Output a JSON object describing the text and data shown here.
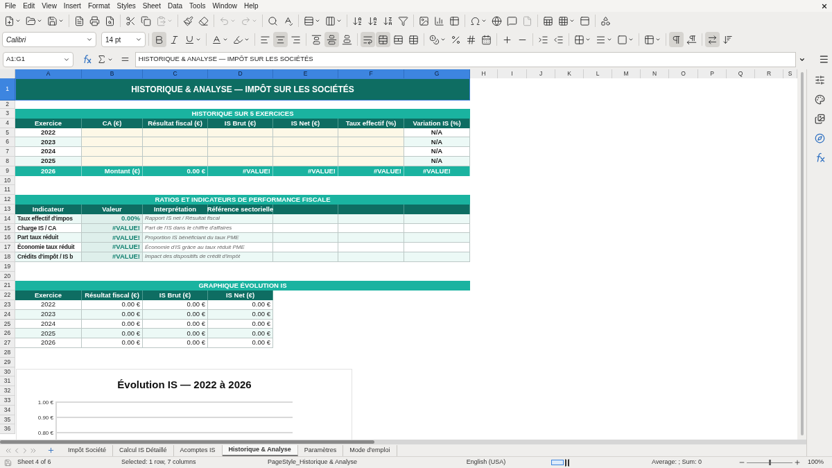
{
  "menu": [
    "File",
    "Edit",
    "View",
    "Insert",
    "Format",
    "Styles",
    "Sheet",
    "Data",
    "Tools",
    "Window",
    "Help"
  ],
  "toolbar_disabled": {
    "paste": true,
    "undo": true,
    "redo": true,
    "header_footer": true
  },
  "font_name": "Calibri",
  "font_size": "14 pt",
  "format_toggles": {
    "bold": true,
    "italic": false,
    "underline": false,
    "align_left": false,
    "align_center": true,
    "align_right": false,
    "align_top": false,
    "align_middle": true,
    "align_bottom": false,
    "wrap_text": true,
    "merge_center": true,
    "ltr": true,
    "rtl": false,
    "text_direction": true
  },
  "name_box": "A1:G1",
  "formula": "HISTORIQUE & ANALYSE — IMPÔT SUR LES SOCIÉTÉS",
  "column_headers": [
    {
      "label": "A",
      "selected": true
    },
    {
      "label": "B",
      "selected": true
    },
    {
      "label": "C",
      "selected": true
    },
    {
      "label": "D",
      "selected": true
    },
    {
      "label": "E",
      "selected": true
    },
    {
      "label": "F",
      "selected": true
    },
    {
      "label": "G",
      "selected": true
    },
    {
      "label": "H",
      "selected": false
    },
    {
      "label": "I",
      "selected": false
    },
    {
      "label": "J",
      "selected": false
    },
    {
      "label": "K",
      "selected": false
    },
    {
      "label": "L",
      "selected": false
    },
    {
      "label": "M",
      "selected": false
    },
    {
      "label": "N",
      "selected": false
    },
    {
      "label": "O",
      "selected": false
    },
    {
      "label": "P",
      "selected": false
    },
    {
      "label": "Q",
      "selected": false
    },
    {
      "label": "R",
      "selected": false
    },
    {
      "label": "S",
      "selected": false
    }
  ],
  "row_headers": [
    {
      "label": "1",
      "selected": true
    },
    {
      "label": "2",
      "selected": false
    },
    {
      "label": "3",
      "selected": false
    },
    {
      "label": "4",
      "selected": false
    },
    {
      "label": "5",
      "selected": false
    },
    {
      "label": "6",
      "selected": false
    },
    {
      "label": "7",
      "selected": false
    },
    {
      "label": "8",
      "selected": false
    },
    {
      "label": "9",
      "selected": false
    },
    {
      "label": "10",
      "selected": false
    },
    {
      "label": "11",
      "selected": false
    },
    {
      "label": "12",
      "selected": false
    },
    {
      "label": "13",
      "selected": false
    },
    {
      "label": "14",
      "selected": false
    },
    {
      "label": "15",
      "selected": false
    },
    {
      "label": "16",
      "selected": false
    },
    {
      "label": "17",
      "selected": false
    },
    {
      "label": "18",
      "selected": false
    },
    {
      "label": "19",
      "selected": false
    },
    {
      "label": "20",
      "selected": false
    },
    {
      "label": "21",
      "selected": false
    },
    {
      "label": "22",
      "selected": false
    },
    {
      "label": "23",
      "selected": false
    },
    {
      "label": "24",
      "selected": false
    },
    {
      "label": "25",
      "selected": false
    },
    {
      "label": "26",
      "selected": false
    },
    {
      "label": "27",
      "selected": false
    },
    {
      "label": "28",
      "selected": false
    },
    {
      "label": "29",
      "selected": false
    },
    {
      "label": "30",
      "selected": false
    },
    {
      "label": "31",
      "selected": false
    },
    {
      "label": "32",
      "selected": false
    },
    {
      "label": "33",
      "selected": false
    },
    {
      "label": "34",
      "selected": false
    },
    {
      "label": "35",
      "selected": false
    },
    {
      "label": "36",
      "selected": false
    }
  ],
  "title": "HISTORIQUE & ANALYSE — IMPÔT SUR LES SOCIÉTÉS",
  "history": {
    "heading": "HISTORIQUE SUR 5 EXERCICES",
    "columns": [
      "Exercice",
      "CA (€)",
      "Résultat fiscal (€)",
      "IS Brut (€)",
      "IS Net (€)",
      "Taux effectif (%)",
      "Variation IS (%)"
    ],
    "rows": [
      {
        "year": "2022",
        "variation": "N/A"
      },
      {
        "year": "2023",
        "variation": "N/A"
      },
      {
        "year": "2024",
        "variation": "N/A"
      },
      {
        "year": "2025",
        "variation": "N/A"
      }
    ],
    "total": {
      "year": "2026",
      "values": [
        "Montant (€)",
        "0.00 €",
        "#VALUE!",
        "#VALUE!",
        "#VALUE!",
        "#VALUE!"
      ]
    }
  },
  "ratios": {
    "heading": "RATIOS ET INDICATEURS DE PERFORMANCE FISCALE",
    "columns": [
      "Indicateur",
      "Valeur",
      "Interprétation",
      "Référence sectorielle"
    ],
    "rows": [
      {
        "indicator": "Taux effectif d'impos",
        "value": "0.00%",
        "note": "Rapport IS net / Résultat fiscal"
      },
      {
        "indicator": "Charge IS / CA",
        "value": "#VALUE!",
        "note": "Part de l'IS dans le chiffre d'affaires"
      },
      {
        "indicator": "Part taux réduit",
        "value": "#VALUE!",
        "note": "Proportion IS bénéficiant du taux PME"
      },
      {
        "indicator": "Économie taux réduit",
        "value": "#VALUE!",
        "note": "Économie d'IS grâce au taux réduit PME"
      },
      {
        "indicator": "Crédits d'impôt / IS b",
        "value": "#VALUE!",
        "note": "Impact des dispositifs de crédit d'impôt"
      }
    ]
  },
  "chart_table": {
    "heading": "GRAPHIQUE ÉVOLUTION IS",
    "columns": [
      "Exercice",
      "Résultat fiscal (€)",
      "IS Brut (€)",
      "IS Net (€)"
    ],
    "rows": [
      [
        "2022",
        "0.00 €",
        "0.00 €",
        "0.00 €"
      ],
      [
        "2023",
        "0.00 €",
        "0.00 €",
        "0.00 €"
      ],
      [
        "2024",
        "0.00 €",
        "0.00 €",
        "0.00 €"
      ],
      [
        "2025",
        "0.00 €",
        "0.00 €",
        "0.00 €"
      ],
      [
        "2026",
        "0.00 €",
        "0.00 €",
        "0.00 €"
      ]
    ]
  },
  "chart": {
    "title": "Évolution IS — 2022 à 2026",
    "y_tick_labels": [
      "1.00 €",
      "0.90 €",
      "0.80 €"
    ]
  },
  "sheet_tabs": [
    {
      "label": "Impôt Société",
      "selected": false
    },
    {
      "label": "Calcul IS Détaillé",
      "selected": false
    },
    {
      "label": "Acomptes IS",
      "selected": false
    },
    {
      "label": "Historique & Analyse",
      "selected": true
    },
    {
      "label": "Paramètres",
      "selected": false
    },
    {
      "label": "Mode d'emploi",
      "selected": false
    }
  ],
  "status": {
    "sheet": "Sheet 4 of 6",
    "selection": "Selected: 1 row, 7 columns",
    "page_style": "PageStyle_Historique & Analyse",
    "language": "English (USA)",
    "sum": "Average: ; Sum: 0",
    "zoom": "100%",
    "zoom_slider": {
      "level": 0.5
    }
  }
}
